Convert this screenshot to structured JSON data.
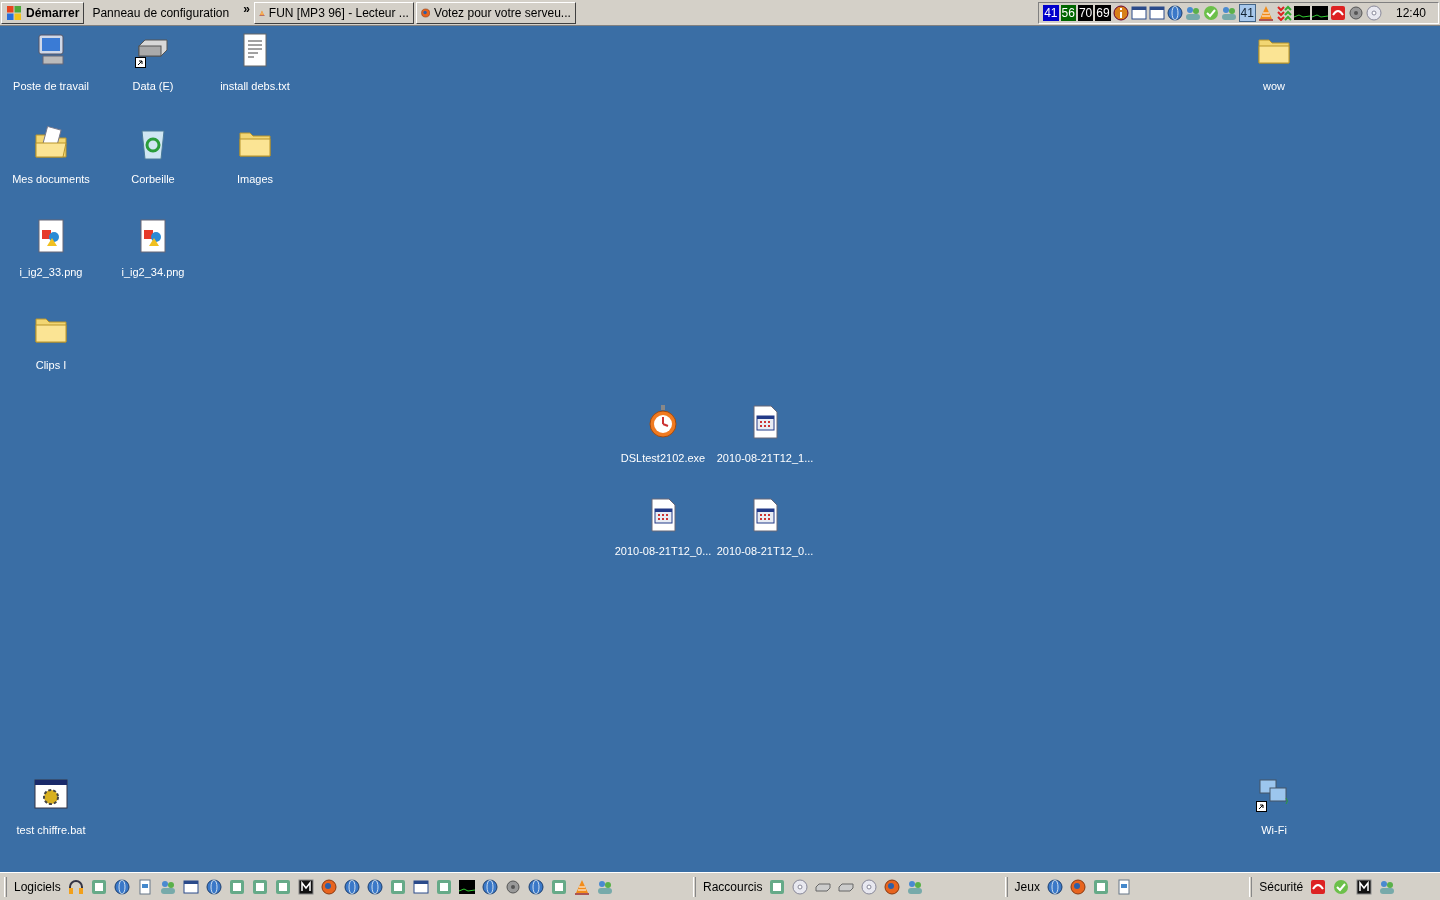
{
  "top_taskbar": {
    "start_button": "Démarrer",
    "toolbar_label": "Panneau de configuration",
    "toolbar_chevron": "»",
    "tasks": [
      {
        "label": "FUN [MP3 96] - Lecteur ...",
        "kind": "cone",
        "selected": false
      },
      {
        "label": "Votez pour votre serveu...",
        "kind": "globe",
        "selected": false
      }
    ],
    "tray_meters": [
      {
        "text": "41",
        "color": "#0000cc"
      },
      {
        "text": "56",
        "color": "#006600"
      },
      {
        "text": "70",
        "color": "#000000"
      },
      {
        "text": "69",
        "color": "#000000"
      }
    ],
    "tray_badge": "41",
    "clock": "12:40"
  },
  "desktop": {
    "top_left": [
      [
        {
          "label": "Poste de travail",
          "kind": "computer",
          "shortcut": false
        },
        {
          "label": "Data (E)",
          "kind": "drive",
          "shortcut": true
        },
        {
          "label": "install debs.txt",
          "kind": "text",
          "shortcut": false
        }
      ],
      [
        {
          "label": "Mes documents",
          "kind": "documents",
          "shortcut": false
        },
        {
          "label": "Corbeille",
          "kind": "recycle",
          "shortcut": false
        },
        {
          "label": "Images",
          "kind": "folder",
          "shortcut": false
        }
      ],
      [
        {
          "label": "i_ig2_33.png",
          "kind": "image",
          "shortcut": false
        },
        {
          "label": "i_ig2_34.png",
          "kind": "image",
          "shortcut": false
        }
      ],
      [
        {
          "label": "Clips I",
          "kind": "folder",
          "shortcut": false
        }
      ]
    ],
    "top_right": [
      {
        "label": "wow",
        "kind": "folder",
        "shortcut": false
      }
    ],
    "center": [
      [
        {
          "label": "DSLtest2102.exe",
          "kind": "stopwatch",
          "shortcut": false
        },
        {
          "label": "2010-08-21T12_1...",
          "kind": "window",
          "shortcut": false
        }
      ],
      [
        {
          "label": "2010-08-21T12_0...",
          "kind": "window",
          "shortcut": false
        },
        {
          "label": "2010-08-21T12_0...",
          "kind": "window",
          "shortcut": false
        }
      ]
    ],
    "bottom_left": [
      {
        "label": "test chiffre.bat",
        "kind": "batch",
        "shortcut": false
      }
    ],
    "bottom_right": [
      {
        "label": "Wi-Fi",
        "kind": "network",
        "shortcut": true
      }
    ]
  },
  "bottom_taskbar": [
    {
      "label": "Logiciels"
    },
    {
      "label": "Raccourcis"
    },
    {
      "label": "Jeux"
    },
    {
      "label": "Sécurité"
    }
  ]
}
